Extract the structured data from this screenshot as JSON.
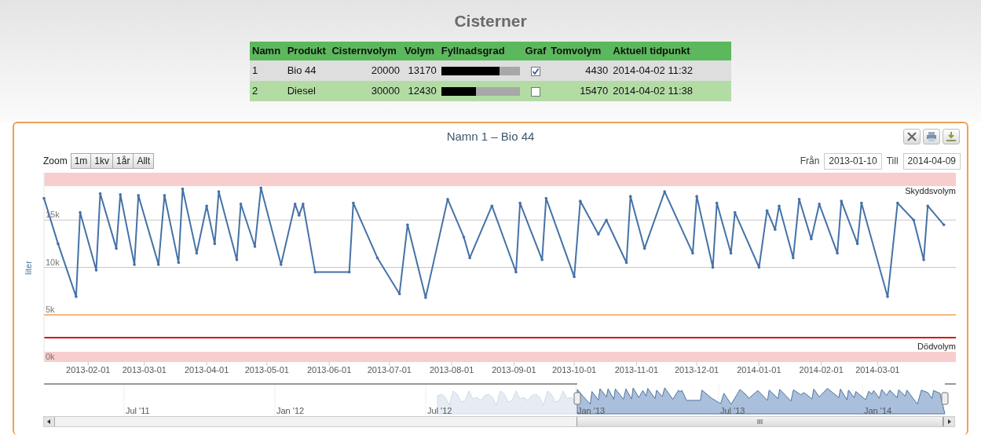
{
  "page_title": "Cisterner",
  "table": {
    "columns": [
      "Namn",
      "Produkt",
      "Cisternvolym",
      "Volym",
      "Fyllnadsgrad",
      "Graf",
      "Tomvolym",
      "Aktuell tidpunkt"
    ],
    "rows": [
      {
        "namn": "1",
        "produkt": "Bio 44",
        "cisternvolym": "20000",
        "volym": "13170",
        "level": 0.74,
        "checked": true,
        "tomvolym": "4430",
        "tidpunkt": "2014-04-02 11:32"
      },
      {
        "namn": "2",
        "produkt": "Diesel",
        "cisternvolym": "30000",
        "volym": "12430",
        "level": 0.44,
        "checked": false,
        "tomvolym": "15470",
        "tidpunkt": "2014-04-02 11:38"
      }
    ]
  },
  "chart": {
    "zoom_label": "Zoom",
    "zoom_buttons": [
      "1m",
      "1kv",
      "1år",
      "Allt"
    ],
    "from_label": "Från",
    "from_value": "2013-01-10",
    "to_label": "Till",
    "to_value": "2014-04-09",
    "chart_data": {
      "type": "line",
      "title": "Namn 1 – Bio 44",
      "ylabel": "liter",
      "xlim": [
        "2013-01-10",
        "2014-04-09"
      ],
      "ylim": [
        0,
        20000
      ],
      "x": [
        "2013-01-10",
        "2013-01-17",
        "2013-01-26",
        "2013-01-28",
        "2013-02-05",
        "2013-02-07",
        "2013-02-15",
        "2013-02-17",
        "2013-02-24",
        "2013-02-26",
        "2013-03-08",
        "2013-03-11",
        "2013-03-18",
        "2013-03-20",
        "2013-03-27",
        "2013-04-01",
        "2013-04-05",
        "2013-04-07",
        "2013-04-16",
        "2013-04-18",
        "2013-04-25",
        "2013-04-28",
        "2013-05-08",
        "2013-05-15",
        "2013-05-17",
        "2013-05-19",
        "2013-05-25",
        "2013-06-11",
        "2013-06-13",
        "2013-06-25",
        "2013-07-06",
        "2013-07-10",
        "2013-07-19",
        "2013-07-30",
        "2013-08-07",
        "2013-08-10",
        "2013-08-21",
        "2013-09-02",
        "2013-09-04",
        "2013-09-15",
        "2013-09-17",
        "2013-10-01",
        "2013-10-04",
        "2013-10-13",
        "2013-10-17",
        "2013-10-27",
        "2013-10-29",
        "2013-11-05",
        "2013-11-15",
        "2013-11-29",
        "2013-12-01",
        "2013-12-09",
        "2013-12-11",
        "2013-12-18",
        "2013-12-20",
        "2014-01-01",
        "2014-01-05",
        "2014-01-09",
        "2014-01-11",
        "2014-01-18",
        "2014-01-21",
        "2014-01-27",
        "2014-01-31",
        "2014-02-09",
        "2014-02-11",
        "2014-02-19",
        "2014-02-21",
        "2014-03-06",
        "2014-03-11",
        "2014-03-19",
        "2014-03-24",
        "2014-03-26",
        "2014-04-03"
      ],
      "series": [
        {
          "color": "#4572a7",
          "values": [
            17300,
            12500,
            6900,
            15800,
            9700,
            17800,
            12000,
            17700,
            10300,
            17600,
            10300,
            17600,
            10500,
            18300,
            11500,
            16500,
            12500,
            18000,
            10800,
            16700,
            12200,
            18400,
            10300,
            16700,
            15500,
            16700,
            9500,
            9500,
            16800,
            11000,
            7200,
            14500,
            6800,
            17200,
            13200,
            11000,
            16500,
            9500,
            16800,
            10800,
            17300,
            9000,
            17000,
            13500,
            15000,
            10500,
            17500,
            12000,
            18000,
            11500,
            17500,
            10000,
            16800,
            11500,
            15800,
            10000,
            16000,
            14000,
            16500,
            11000,
            17200,
            13000,
            16700,
            11500,
            17000,
            12500,
            16800,
            6900,
            16800,
            15000,
            10800,
            16500,
            14500
          ]
        }
      ],
      "yticks": [
        {
          "value": 0,
          "label": "0k"
        },
        {
          "value": 5000,
          "label": "5k"
        },
        {
          "value": 10000,
          "label": "10k"
        },
        {
          "value": 15000,
          "label": "15k"
        }
      ],
      "xticks": [
        "2013-02-01",
        "2013-03-01",
        "2013-04-01",
        "2013-05-01",
        "2013-06-01",
        "2013-07-01",
        "2013-08-01",
        "2013-09-01",
        "2013-10-01",
        "2013-11-01",
        "2013-12-01",
        "2014-01-01",
        "2014-02-01",
        "2014-03-01"
      ],
      "annotations": [
        {
          "text": "Skyddsvolym"
        },
        {
          "text": "Dödvolym"
        }
      ]
    },
    "navigator_labels": [
      "Jul '11",
      "Jan '12",
      "Jul '12",
      "Jan '13",
      "Jul '13",
      "Jan '14"
    ]
  }
}
